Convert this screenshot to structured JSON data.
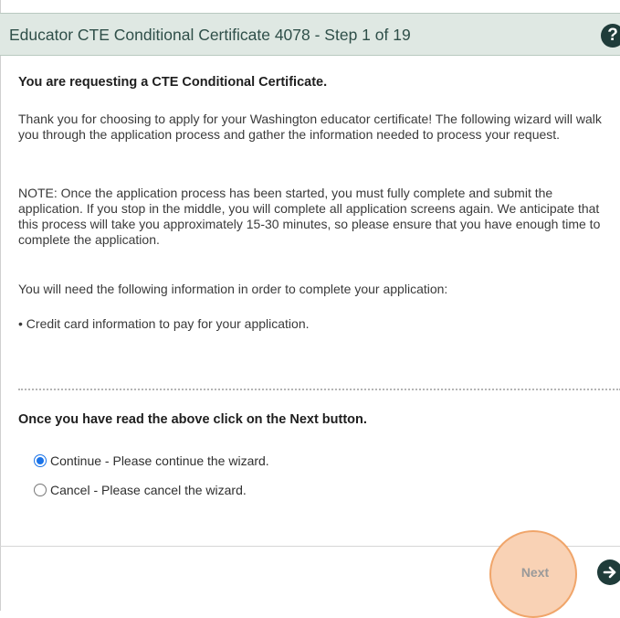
{
  "wizard": {
    "title": "Educator CTE Conditional Certificate 4078 - Step 1 of 19",
    "help_symbol": "?"
  },
  "content": {
    "heading": "You are requesting a CTE Conditional Certificate.",
    "paragraph_1": "Thank you for choosing to apply for your Washington educator certificate! The following wizard will walk you through the application process and gather the information needed to process your request.",
    "paragraph_2": "NOTE: Once the application process has been started, you must fully complete and submit the application. If you stop in the middle, you will complete all application screens again. We anticipate that this process will take you approximately 15-30 minutes, so please ensure that you have enough time to complete the application.",
    "paragraph_3": "You will need the following information in order to complete your application:",
    "bullet_1": "• Credit card information to pay for your application.",
    "instruction": "Once you have read the above click on the Next button."
  },
  "options": [
    {
      "label": "Continue - Please continue the wizard.",
      "selected": true
    },
    {
      "label": "Cancel - Please cancel the wizard.",
      "selected": false
    }
  ],
  "footer": {
    "next_label": "Next",
    "next_arrow_icon": "arrow-right-icon"
  },
  "colors": {
    "header_bg": "#dfe8e3",
    "header_text": "#2f4f49",
    "accent_dark": "#1f3c3a",
    "radio_selected": "#1a73e8",
    "highlight_fill": "#f9d2b5",
    "highlight_border": "#f0a56a"
  }
}
